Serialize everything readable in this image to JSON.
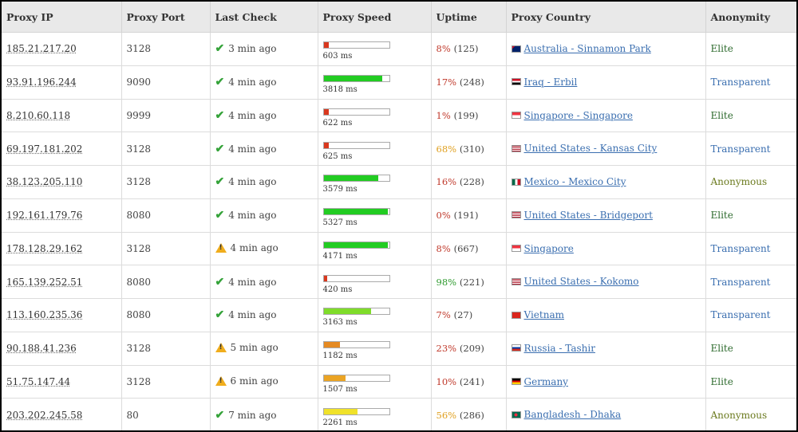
{
  "columns": [
    "Proxy IP",
    "Proxy Port",
    "Last Check",
    "Proxy Speed",
    "Uptime",
    "Proxy Country",
    "Anonymity"
  ],
  "colors": {
    "check_ok": "#35a33a",
    "warning": "#f0ad1c",
    "link": "#3b6fb0",
    "elite": "#2e6b2e",
    "transparent": "#3b6fb0",
    "anonymous": "#6b7a1e"
  },
  "rows": [
    {
      "ip": "185.21.217.20",
      "port": "3128",
      "status_icon": "check-icon",
      "last_check": "3 min ago",
      "speed_fraction": 0.08,
      "speed_color": "#d9381e",
      "speed": "603 ms",
      "uptime_pct": "8%",
      "uptime_color": "#c0392b",
      "uptime_count": "(125)",
      "flag_icon": "flag-australia-icon",
      "country": "Australia - Sinnamon Park",
      "anonymity": "Elite",
      "anon_color": "#2e6b2e"
    },
    {
      "ip": "93.91.196.244",
      "port": "9090",
      "status_icon": "check-icon",
      "last_check": "4 min ago",
      "speed_fraction": 0.9,
      "speed_color": "#22cc22",
      "speed": "3818 ms",
      "uptime_pct": "17%",
      "uptime_color": "#c0392b",
      "uptime_count": "(248)",
      "flag_icon": "flag-iraq-icon",
      "country": "Iraq - Erbil",
      "anonymity": "Transparent",
      "anon_color": "#3b6fb0"
    },
    {
      "ip": "8.210.60.118",
      "port": "9999",
      "status_icon": "check-icon",
      "last_check": "4 min ago",
      "speed_fraction": 0.08,
      "speed_color": "#d9381e",
      "speed": "622 ms",
      "uptime_pct": "1%",
      "uptime_color": "#c0392b",
      "uptime_count": "(199)",
      "flag_icon": "flag-singapore-icon",
      "country": "Singapore - Singapore",
      "anonymity": "Elite",
      "anon_color": "#2e6b2e"
    },
    {
      "ip": "69.197.181.202",
      "port": "3128",
      "status_icon": "check-icon",
      "last_check": "4 min ago",
      "speed_fraction": 0.08,
      "speed_color": "#d9381e",
      "speed": "625 ms",
      "uptime_pct": "68%",
      "uptime_color": "#e0a020",
      "uptime_count": "(310)",
      "flag_icon": "flag-united-states-icon",
      "country": "United States - Kansas City",
      "anonymity": "Transparent",
      "anon_color": "#3b6fb0"
    },
    {
      "ip": "38.123.205.110",
      "port": "3128",
      "status_icon": "check-icon",
      "last_check": "4 min ago",
      "speed_fraction": 0.84,
      "speed_color": "#22cc22",
      "speed": "3579 ms",
      "uptime_pct": "16%",
      "uptime_color": "#c0392b",
      "uptime_count": "(228)",
      "flag_icon": "flag-mexico-icon",
      "country": "Mexico - Mexico City",
      "anonymity": "Anonymous",
      "anon_color": "#6b7a1e"
    },
    {
      "ip": "192.161.179.76",
      "port": "8080",
      "status_icon": "check-icon",
      "last_check": "4 min ago",
      "speed_fraction": 0.98,
      "speed_color": "#22cc22",
      "speed": "5327 ms",
      "uptime_pct": "0%",
      "uptime_color": "#c0392b",
      "uptime_count": "(191)",
      "flag_icon": "flag-united-states-icon",
      "country": "United States - Bridgeport",
      "anonymity": "Elite",
      "anon_color": "#2e6b2e"
    },
    {
      "ip": "178.128.29.162",
      "port": "3128",
      "status_icon": "warning-icon",
      "last_check": "4 min ago",
      "speed_fraction": 0.98,
      "speed_color": "#22cc22",
      "speed": "4171 ms",
      "uptime_pct": "8%",
      "uptime_color": "#c0392b",
      "uptime_count": "(667)",
      "flag_icon": "flag-singapore-icon",
      "country": "Singapore",
      "anonymity": "Transparent",
      "anon_color": "#3b6fb0"
    },
    {
      "ip": "165.139.252.51",
      "port": "8080",
      "status_icon": "check-icon",
      "last_check": "4 min ago",
      "speed_fraction": 0.05,
      "speed_color": "#d9381e",
      "speed": "420 ms",
      "uptime_pct": "98%",
      "uptime_color": "#2e9a2e",
      "uptime_count": "(221)",
      "flag_icon": "flag-united-states-icon",
      "country": "United States - Kokomo",
      "anonymity": "Transparent",
      "anon_color": "#3b6fb0"
    },
    {
      "ip": "113.160.235.36",
      "port": "8080",
      "status_icon": "check-icon",
      "last_check": "4 min ago",
      "speed_fraction": 0.73,
      "speed_color": "#7fdc2a",
      "speed": "3163 ms",
      "uptime_pct": "7%",
      "uptime_color": "#c0392b",
      "uptime_count": "(27)",
      "flag_icon": "flag-vietnam-icon",
      "country": "Vietnam",
      "anonymity": "Transparent",
      "anon_color": "#3b6fb0"
    },
    {
      "ip": "90.188.41.236",
      "port": "3128",
      "status_icon": "warning-icon",
      "last_check": "5 min ago",
      "speed_fraction": 0.25,
      "speed_color": "#e58a22",
      "speed": "1182 ms",
      "uptime_pct": "23%",
      "uptime_color": "#c0392b",
      "uptime_count": "(209)",
      "flag_icon": "flag-russia-icon",
      "country": "Russia - Tashir",
      "anonymity": "Elite",
      "anon_color": "#2e6b2e"
    },
    {
      "ip": "51.75.147.44",
      "port": "3128",
      "status_icon": "warning-icon",
      "last_check": "6 min ago",
      "speed_fraction": 0.33,
      "speed_color": "#eba424",
      "speed": "1507 ms",
      "uptime_pct": "10%",
      "uptime_color": "#c0392b",
      "uptime_count": "(241)",
      "flag_icon": "flag-germany-icon",
      "country": "Germany",
      "anonymity": "Elite",
      "anon_color": "#2e6b2e"
    },
    {
      "ip": "203.202.245.58",
      "port": "80",
      "status_icon": "check-icon",
      "last_check": "7 min ago",
      "speed_fraction": 0.52,
      "speed_color": "#f0e22a",
      "speed": "2261 ms",
      "uptime_pct": "56%",
      "uptime_color": "#e0a020",
      "uptime_count": "(286)",
      "flag_icon": "flag-bangladesh-icon",
      "country": "Bangladesh - Dhaka",
      "anonymity": "Anonymous",
      "anon_color": "#6b7a1e"
    }
  ]
}
